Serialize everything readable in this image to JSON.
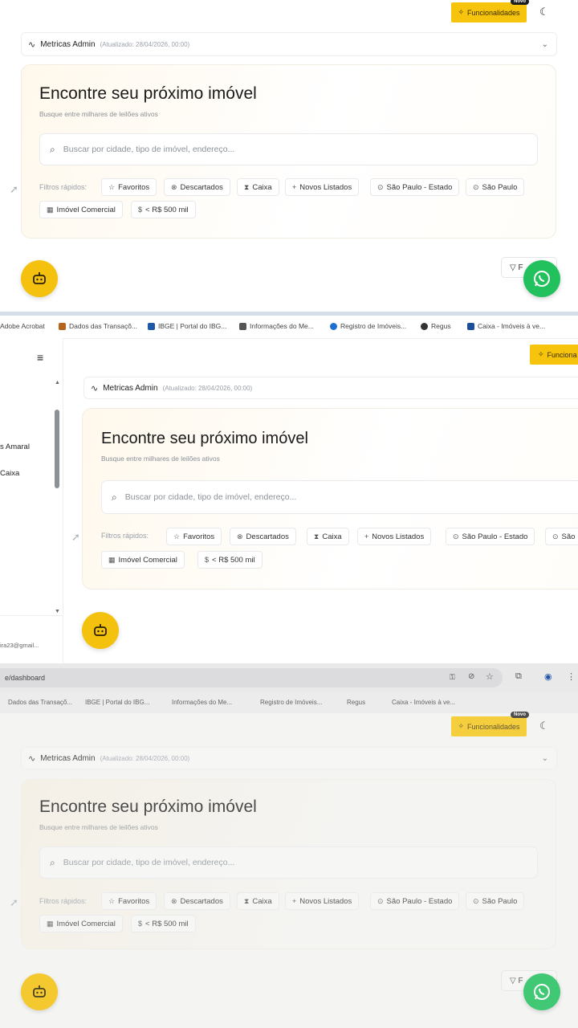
{
  "header": {
    "features_label": "Funcionalidades",
    "new_badge": "Novo",
    "theme_icon": "moon-icon"
  },
  "metrics": {
    "label": "Metricas Admin",
    "updated": "(Atualizado: 28/04/2026, 00:00)"
  },
  "hero": {
    "title": "Encontre seu próximo imóvel",
    "subtitle": "Busque entre milhares de leilões ativos",
    "search_placeholder": "Buscar por cidade, tipo de imóvel, endereço..."
  },
  "quick_filters": {
    "label": "Filtros rápidos:",
    "chips": [
      {
        "icon": "star-icon",
        "label": "Favoritos"
      },
      {
        "icon": "circle-x-icon",
        "label": "Descartados"
      },
      {
        "icon": "hourglass-icon",
        "label": "Caixa"
      },
      {
        "icon": "plus-icon",
        "label": "Novos Listados"
      },
      {
        "icon": "pin-icon",
        "label": "São Paulo - Estado"
      },
      {
        "icon": "pin-icon",
        "label": "São Paulo"
      },
      {
        "icon": "building-icon",
        "label": "Imóvel Comercial"
      },
      {
        "icon": "dollar-icon",
        "label": "< R$ 500 mil"
      }
    ],
    "chip_partial_s2": "São"
  },
  "filter_button_partial": "F",
  "filter_button_partial_s3": "F",
  "bookmarks": [
    {
      "label": "Adobe Acrobat",
      "color": "#d0342c"
    },
    {
      "label": "Dados das Transaçõ...",
      "color": "#b5651d"
    },
    {
      "label": "IBGE | Portal do IBG...",
      "color": "#1e58a8"
    },
    {
      "label": "Informações do Me...",
      "color": "#555555"
    },
    {
      "label": "Registro de Imóveis...",
      "color": "#1f6fd1"
    },
    {
      "label": "Regus",
      "color": "#333333"
    },
    {
      "label": "Caixa - Imóveis à ve...",
      "color": "#1b4f9c"
    }
  ],
  "bookmarks_s3": [
    "Dados das Transaçõ...",
    "IBGE | Portal do IBG...",
    "Informações do Me...",
    "Registro de Imóveis...",
    "Regus",
    "Caixa - Imóveis à ve..."
  ],
  "sidebar": {
    "item1": "s Amaral",
    "item2": "Caixa",
    "email": "ira23@gmail..."
  },
  "url": "e/dashboard",
  "features_partial_s2": "Funciona",
  "colors": {
    "accent": "#f6c40c",
    "whatsapp": "#22c15e"
  }
}
